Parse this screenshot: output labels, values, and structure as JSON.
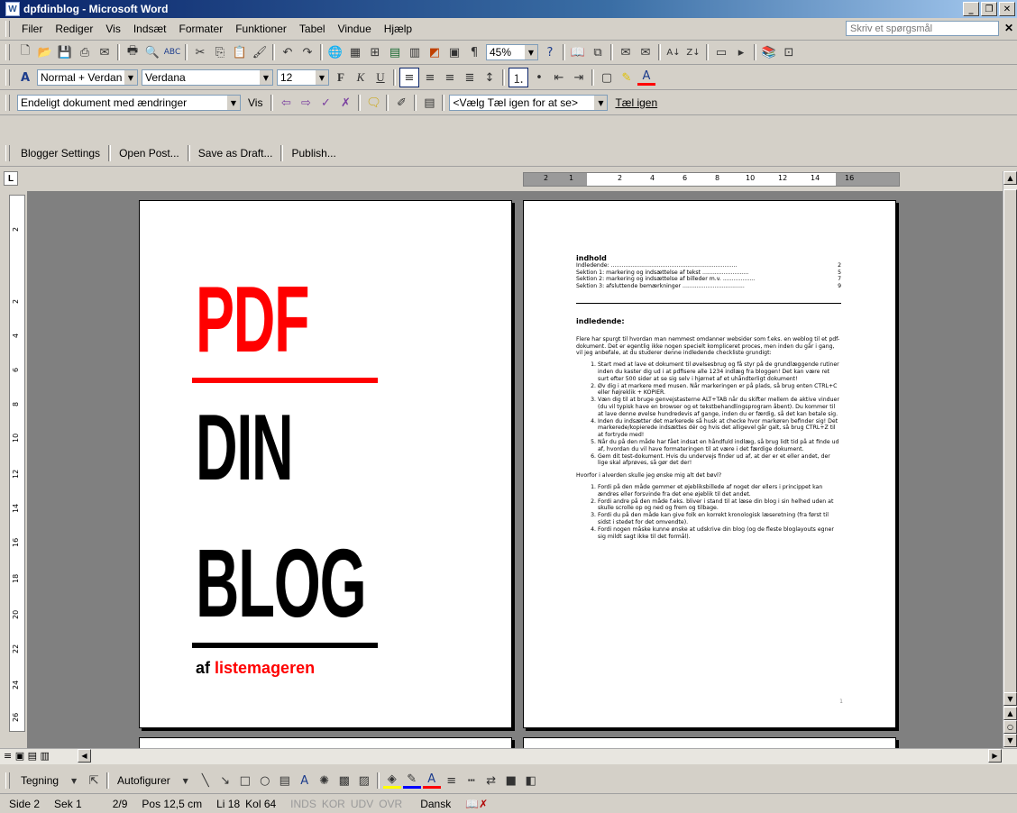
{
  "window": {
    "title": "dpfdinblog - Microsoft Word"
  },
  "menu": [
    "Filer",
    "Rediger",
    "Vis",
    "Indsæt",
    "Formater",
    "Funktioner",
    "Tabel",
    "Vindue",
    "Hjælp"
  ],
  "ask_box": "Skriv et spørgsmål",
  "toolbar_standard": {
    "zoom": "45%"
  },
  "toolbar_format": {
    "style": "Normal + Verdan",
    "font": "Verdana",
    "size": "12"
  },
  "toolbar_review": {
    "display_mode": "Endeligt dokument med ændringer",
    "show_label": "Vis",
    "track_combo": "<Vælg Tæl igen for at se>",
    "track_label": "Tæl igen"
  },
  "toolbar_blogger": [
    "Blogger Settings",
    "Open Post...",
    "Save as Draft...",
    "Publish..."
  ],
  "hruler_ticks": [
    "2",
    "1",
    "2",
    "4",
    "6",
    "8",
    "10",
    "12",
    "14",
    "16"
  ],
  "vruler_ticks": [
    "2",
    "2",
    "4",
    "6",
    "8",
    "10",
    "12",
    "14",
    "16",
    "18",
    "20",
    "22",
    "24",
    "26"
  ],
  "cover": {
    "line1": "PDF",
    "line2": "DIN",
    "line3": "BLOG",
    "byline_prefix": "af",
    "byline_name": "listemageren"
  },
  "doc": {
    "toc_title": "indhold",
    "toc": [
      {
        "label": "Indledende: .......................................................................",
        "page": "2"
      },
      {
        "label": "Sektion 1: markering og indsættelse af tekst ..........................",
        "page": "5"
      },
      {
        "label": "Sektion 2: markering og indsættelse af billeder m.v. ..................",
        "page": "7"
      },
      {
        "label": "Sektion 3: afsluttende bemærkninger ...................................",
        "page": "9"
      }
    ],
    "section_title": "indledende:",
    "intro": "Flere har spurgt til hvordan man nemmest omdanner websider som f.eks. en weblog til et pdf-dokument. Det er egentlig ikke nogen specielt kompliceret proces, men inden du går i gang, vil jeg anbefale, at du studerer denne indledende checkliste grundigt:",
    "list1": [
      "Start med at lave et dokument til øvelsesbrug og få styr på de grundlæggende rutiner inden du kaster dig ud i at pdfisere alle 1234 indlæg fra bloggen! Det kan være ret surt efter 500 sider at se sig selv i hjørnet af et uhåndterligt dokument!",
      "Øv dig i at markere med musen. Når markeringen er på plads, så brug enten CTRL+C eller højreklik + KOPIER.",
      "Væn dig til at bruge genvejstasterne ALT+TAB når du skifter mellem de aktive vinduer (du vil typisk have en browser og et tekstbehandlingsprogram åbent). Du kommer til at lave denne øvelse hundredevis af gange, inden du er færdig, så det kan betale sig.",
      "Inden du indsætter det markerede så husk at checke hvor markøren befinder sig! Det markerede/kopierede indsættes dér og hvis det alligevel går galt, så brug CTRL+Z til at fortryde med!",
      "Når du på den måde har fået indsat en håndfuld indlæg, så brug lidt tid på at finde ud af, hvordan du vil have formateringen til at være i det færdige dokument.",
      "Gem dit test-dokument. Hvis du undervejs finder ud af, at der er et eller andet, der lige skal afprøves, så gør det der!"
    ],
    "question": "Hvorfor i alverden skulle jeg ønske mig alt det bøvl?",
    "list2": [
      "Fordi på den måde gemmer et øjebliksbillede af noget der ellers i princippet kan ændres eller forsvinde fra det ene øjeblik til det andet.",
      "Fordi andre på den måde f.eks. bliver i stand til at læse din blog i sin helhed uden at skulle scrolle op og ned og frem og tilbage.",
      "Fordi du på den måde kan give folk en korrekt kronologisk læseretning (fra først til sidst i stedet for det omvendte).",
      "Fordi nogen måske kunne ønske at udskrive din blog (og de fleste bloglayouts egner sig mildt sagt ikke til det formål)."
    ],
    "page_number": "1"
  },
  "drawbar": {
    "draw_label": "Tegning",
    "autoshapes_label": "Autofigurer"
  },
  "status": {
    "page": "Side 2",
    "section": "Sek 1",
    "pages": "2/9",
    "position": "Pos 12,5 cm",
    "line": "Li 18",
    "col": "Kol 64",
    "rec": "INDS",
    "trk": "KOR",
    "ext": "UDV",
    "ovr": "OVR",
    "lang": "Dansk"
  },
  "colors": {
    "red": "#ff0000",
    "title_bar": "#0a246a"
  }
}
